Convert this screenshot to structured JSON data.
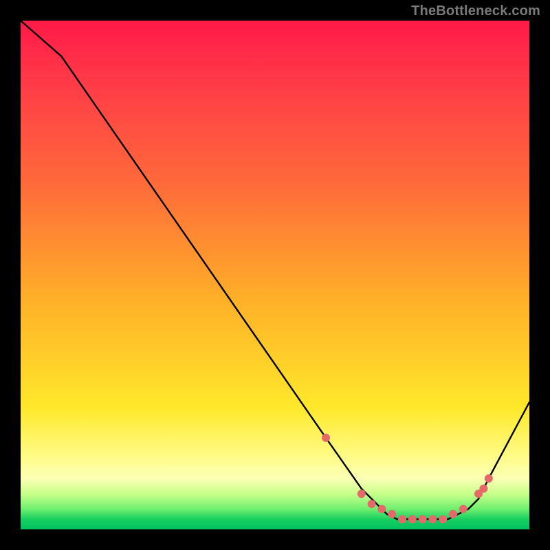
{
  "watermark": "TheBottleneck.com",
  "chart_data": {
    "type": "line",
    "title": "",
    "xlabel": "",
    "ylabel": "",
    "xlim": [
      0,
      100
    ],
    "ylim": [
      0,
      100
    ],
    "grid": false,
    "legend": false,
    "series": [
      {
        "name": "bottleneck-curve",
        "x": [
          0,
          8,
          60,
          67,
          70,
          72,
          74,
          76,
          78,
          80,
          82,
          84,
          86,
          88,
          90,
          92,
          100
        ],
        "values": [
          100,
          93,
          18,
          8,
          5,
          3,
          2,
          2,
          2,
          2,
          2,
          2,
          3,
          4,
          6,
          10,
          25
        ]
      }
    ],
    "markers": {
      "name": "highlight-points",
      "color": "#e46a6a",
      "x": [
        60,
        67,
        69,
        71,
        73,
        75,
        77,
        79,
        81,
        83,
        85,
        87,
        90,
        91,
        92
      ],
      "values": [
        18,
        7,
        5,
        4,
        3,
        2,
        2,
        2,
        2,
        2,
        3,
        4,
        7,
        8,
        10
      ]
    }
  }
}
